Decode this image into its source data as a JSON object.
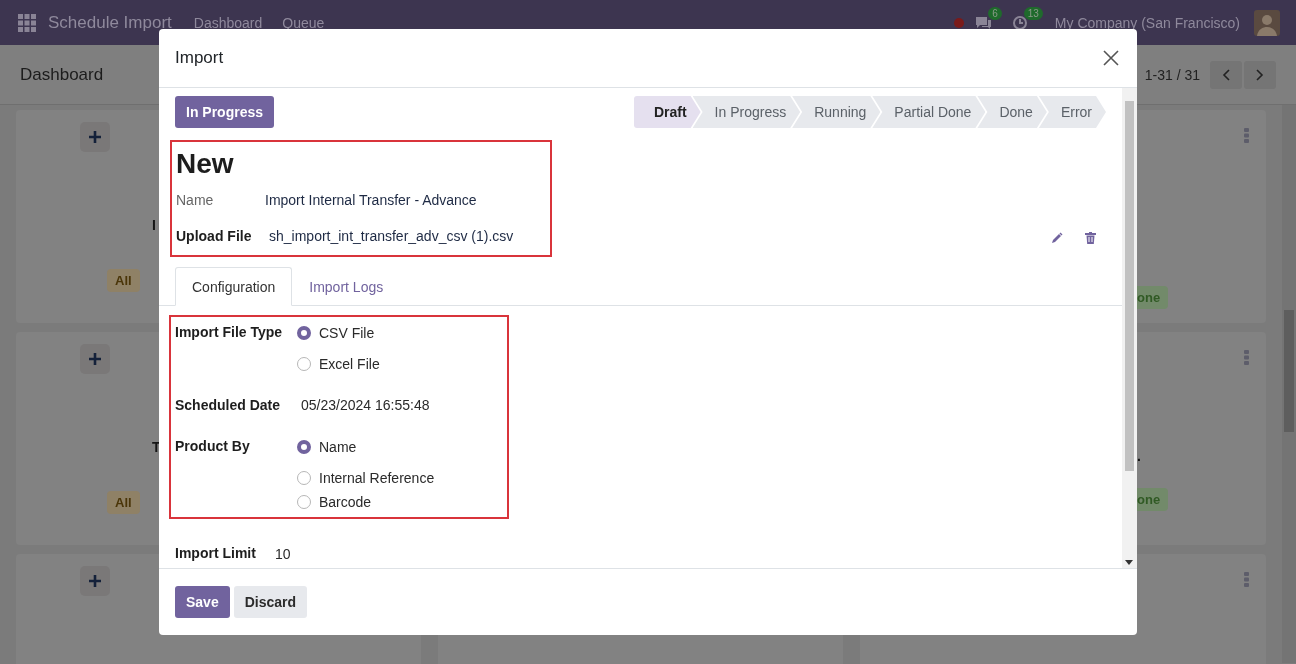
{
  "navbar": {
    "app_name": "Schedule Import",
    "menu": [
      "Dashboard",
      "Queue"
    ],
    "message_count": "6",
    "activity_count": "13",
    "company": "My Company (San Francisco)"
  },
  "control_panel": {
    "title": "Dashboard",
    "pager": "1-31 / 31"
  },
  "left_cards": [
    {
      "kind": "labelled",
      "title": "I",
      "badge": "All"
    },
    {
      "kind": "labelled",
      "title": "T",
      "badge": "All"
    },
    {
      "kind": "plain"
    }
  ],
  "right_cards": [
    {
      "kind": "labelled",
      "badge": "one"
    },
    {
      "kind": "labelled",
      "title": ".",
      "badge": "one"
    },
    {
      "kind": "plain"
    }
  ],
  "dialog": {
    "title": "Import",
    "state_button": "In Progress",
    "stages": [
      {
        "label": "Draft",
        "selected": true
      },
      {
        "label": "In Progress",
        "selected": false
      },
      {
        "label": "Running",
        "selected": false
      },
      {
        "label": "Partial Done",
        "selected": false
      },
      {
        "label": "Done",
        "selected": false
      },
      {
        "label": "Error",
        "selected": false
      }
    ],
    "record_name": "New",
    "fields": [
      {
        "kind": "text",
        "label": "Name",
        "value": "Import Internal Transfer - Advance"
      },
      {
        "kind": "file",
        "label": "Upload File",
        "value": "sh_import_int_transfer_adv_csv (1).csv"
      }
    ],
    "tabs": [
      {
        "label": "Configuration",
        "selected": true
      },
      {
        "label": "Import Logs",
        "selected": false
      }
    ],
    "config": [
      {
        "kind": "radio",
        "label": "Import File Type",
        "options": [
          {
            "label": "CSV File",
            "selected": true
          },
          {
            "label": "Excel File",
            "selected": false
          }
        ]
      },
      {
        "kind": "text",
        "label": "Scheduled Date",
        "value": "05/23/2024 16:55:48"
      },
      {
        "kind": "radio",
        "label": "Product By",
        "options": [
          {
            "label": "Name",
            "selected": true
          },
          {
            "label": "Internal Reference",
            "selected": false
          },
          {
            "label": "Barcode",
            "selected": false
          }
        ]
      }
    ],
    "import_limit": {
      "label": "Import Limit",
      "value": "10"
    },
    "buttons": [
      {
        "kind": "primary",
        "label": "Save"
      },
      {
        "kind": "secondary",
        "label": "Discard"
      }
    ]
  }
}
